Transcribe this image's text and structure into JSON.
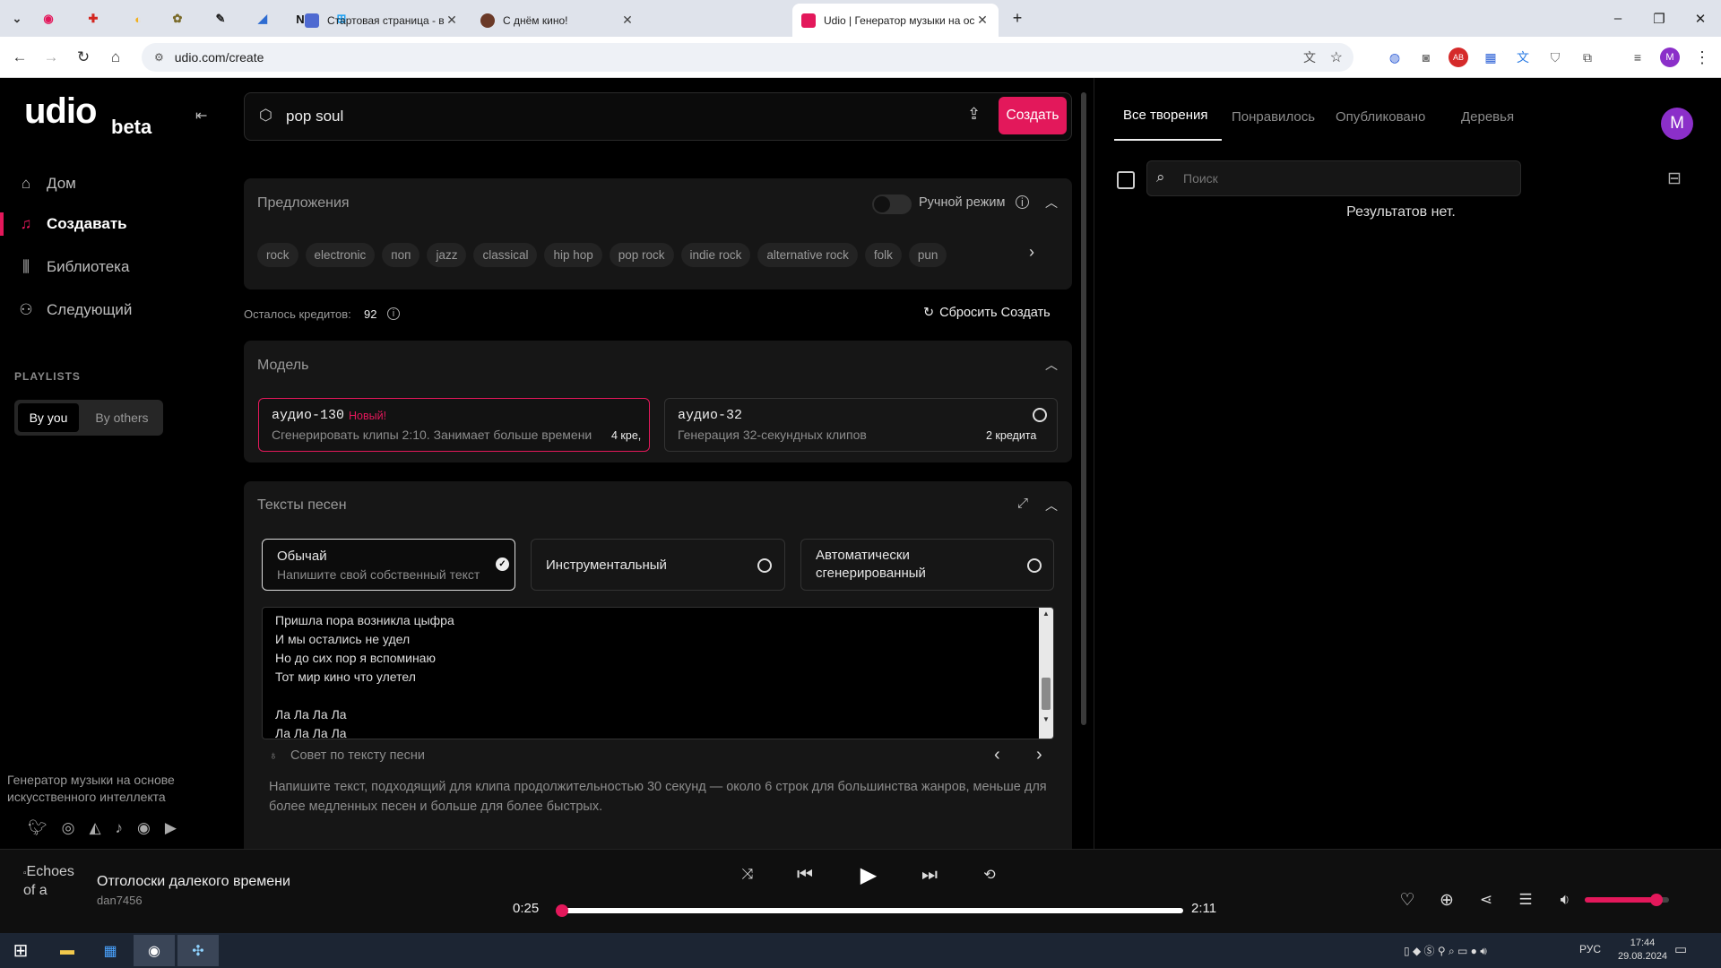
{
  "browser": {
    "tabs": [
      {
        "title": "Стартовая страница - визуаль",
        "favicon": "grid-icon",
        "color": "#4f6ad1"
      },
      {
        "title": "С днём кино!",
        "favicon": "film-icon",
        "color": "#6b3a28"
      },
      {
        "title": "Udio | Генератор музыки на ос",
        "favicon": "udio-icon",
        "color": "#e3185b"
      }
    ],
    "pinned_tabs": [
      {
        "icon": "pinned-site-icon",
        "color": "#e3185b",
        "glyph": "◉"
      },
      {
        "icon": "pinned-site-icon",
        "color": "#d3261f",
        "glyph": "✚"
      },
      {
        "icon": "pinned-site-icon",
        "color": "#f2b01e",
        "glyph": "◐"
      },
      {
        "icon": "pinned-site-icon",
        "color": "#7a6b2a",
        "glyph": "✿"
      },
      {
        "icon": "pinned-site-icon",
        "color": "#222222",
        "glyph": "✎"
      },
      {
        "icon": "pinned-site-icon",
        "color": "#2e6cd1",
        "glyph": "◢"
      },
      {
        "icon": "pinned-site-icon",
        "color": "#111111",
        "glyph": "N"
      },
      {
        "icon": "pinned-site-icon",
        "color": "#1ea1f2",
        "glyph": "⊞"
      }
    ],
    "url": "udio.com/create",
    "new_tab": "+",
    "window_controls": [
      "–",
      "❐",
      "✕"
    ]
  },
  "sidebar": {
    "logo": "udio",
    "logo_suffix": "beta",
    "nav": [
      {
        "label": "Дом",
        "icon": "home-icon",
        "active": false
      },
      {
        "label": "Создавать",
        "icon": "create-music-icon",
        "active": true
      },
      {
        "label": "Библиотека",
        "icon": "library-icon",
        "active": false
      },
      {
        "label": "Следующий",
        "icon": "person-icon",
        "active": false
      }
    ],
    "playlists_heading": "PLAYLISTS",
    "playlist_tabs": [
      "By you",
      "By others"
    ],
    "footer_text": "Генератор музыки на основе искусственного интеллекта",
    "social_icons": [
      "twitter-icon",
      "instagram-icon",
      "discord-icon",
      "tiktok-icon",
      "reddit-icon",
      "youtube-icon"
    ]
  },
  "prompt": {
    "value": "pop soul",
    "create_label": "Создать",
    "accent": "#e3185b"
  },
  "suggestions": {
    "title": "Предложения",
    "manual_mode_label": "Ручной режим",
    "manual_mode_on": false,
    "chips": [
      "rock",
      "electronic",
      "поп",
      "jazz",
      "classical",
      "hip hop",
      "pop rock",
      "indie rock",
      "alternative rock",
      "folk",
      "pun"
    ]
  },
  "credits": {
    "label": "Осталось кредитов:",
    "value": "92",
    "reset_label": "Сбросить Создать"
  },
  "model": {
    "title": "Модель",
    "options": [
      {
        "name": "аудио-130",
        "badge": "Новый!",
        "desc": "Сгенерировать клипы 2:10. Занимает больше времени",
        "cost": "4 кре,",
        "selected": true
      },
      {
        "name": "аудио-32",
        "badge": "",
        "desc": "Генерация 32-секундных клипов",
        "cost": "2 кредита",
        "selected": false
      }
    ]
  },
  "lyrics": {
    "title": "Тексты песен",
    "options": [
      {
        "title": "Обычай",
        "sub": "Напишите свой собственный текст",
        "selected": true
      },
      {
        "title": "Инструментальный",
        "sub": "",
        "selected": false
      },
      {
        "title": "Автоматически сгенерированный",
        "sub": "",
        "selected": false
      }
    ],
    "text_lines": [
      "Пришла пора возникла цыфра",
      "И мы остались не удел",
      "Но до сих пор я вспоминаю",
      "Тот мир кино что улетел",
      "",
      "Ла Ла Ла Ла",
      "Ла Ла Ла Ла"
    ],
    "tip_title": "Совет по тексту песни",
    "tip_body": "Напишите текст, подходящий для клипа продолжительностью 30 секунд — около 6 строк для большинства жанров, меньше для более медленных песен и больше для более быстрых."
  },
  "right_panel": {
    "tabs": [
      "Все творения",
      "Понравилось",
      "Опубликовано",
      "Деревья"
    ],
    "active_tab": 0,
    "search_placeholder": "Поиск",
    "empty_text": "Результатов нет.",
    "avatar_letter": "M",
    "avatar_color": "#8b2fc9"
  },
  "player": {
    "cover_alt": "Echoes of a",
    "title": "Отголоски далекого времени",
    "artist": "dan7456",
    "elapsed": "0:25",
    "duration": "2:11",
    "progress": 0.0,
    "volume": 0.85
  },
  "taskbar": {
    "lang": "РУС",
    "time": "17:44",
    "date": "29.08.2024"
  }
}
